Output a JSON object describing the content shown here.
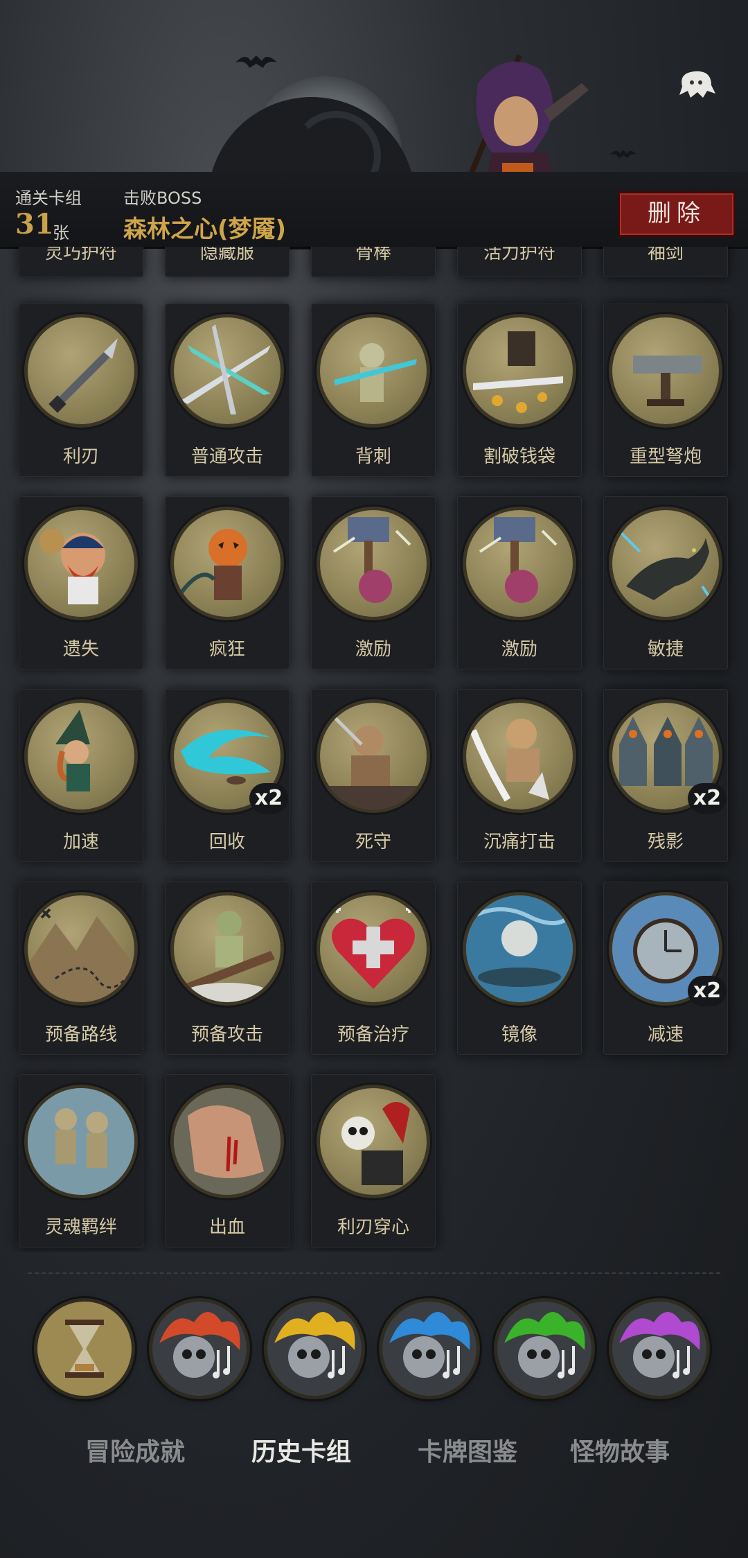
{
  "header": {
    "cleared_label": "通关卡组",
    "cleared_count": "31",
    "cleared_unit": "张",
    "boss_label": "击败BOSS",
    "boss_name": "森林之心(梦魇)",
    "delete_label": "删除"
  },
  "colors": {
    "accent_gold": "#c9a24a",
    "delete_red": "#7a1a18",
    "card_bg": "#1d1f22"
  },
  "top_row_labels": [
    "灵巧护符",
    "隐藏服",
    "骨棒",
    "活力护符",
    "袖剑"
  ],
  "cards": [
    {
      "label": "利刃",
      "icon": "dagger-icon"
    },
    {
      "label": "普通攻击",
      "icon": "slash-icon"
    },
    {
      "label": "背刺",
      "icon": "backstab-icon"
    },
    {
      "label": "割破钱袋",
      "icon": "coin-slash-icon"
    },
    {
      "label": "重型弩炮",
      "icon": "ballista-icon"
    },
    {
      "label": "遗失",
      "icon": "pirate-icon"
    },
    {
      "label": "疯狂",
      "icon": "pumpkin-icon"
    },
    {
      "label": "激励",
      "icon": "hammer-icon"
    },
    {
      "label": "激励",
      "icon": "hammer-icon"
    },
    {
      "label": "敏捷",
      "icon": "panther-icon"
    },
    {
      "label": "加速",
      "icon": "witch-icon"
    },
    {
      "label": "回收",
      "icon": "vortex-icon",
      "count": "x2"
    },
    {
      "label": "死守",
      "icon": "warrior-icon"
    },
    {
      "label": "沉痛打击",
      "icon": "smash-icon"
    },
    {
      "label": "残影",
      "icon": "shadow-icon",
      "count": "x2"
    },
    {
      "label": "预备路线",
      "icon": "map-icon"
    },
    {
      "label": "预备攻击",
      "icon": "puppet-icon"
    },
    {
      "label": "预备治疗",
      "icon": "heart-icon"
    },
    {
      "label": "镜像",
      "icon": "moon-icon"
    },
    {
      "label": "减速",
      "icon": "clock-icon",
      "count": "x2"
    },
    {
      "label": "灵魂羁绊",
      "icon": "souls-icon"
    },
    {
      "label": "出血",
      "icon": "blood-icon"
    },
    {
      "label": "利刃穿心",
      "icon": "skull-icon"
    }
  ],
  "relics": [
    {
      "icon": "hourglass-icon",
      "color": "#9c8a52"
    },
    {
      "icon": "skull-music-icon",
      "color": "#d24a2a"
    },
    {
      "icon": "skull-music-icon",
      "color": "#e0b020"
    },
    {
      "icon": "skull-music-icon",
      "color": "#2f8ad8"
    },
    {
      "icon": "skull-music-icon",
      "color": "#3ab22a"
    },
    {
      "icon": "skull-music-icon",
      "color": "#b04ad0"
    }
  ],
  "tabs": [
    {
      "label": "冒险成就",
      "active": false
    },
    {
      "label": "历史卡组",
      "active": true
    },
    {
      "label": "卡牌图鉴",
      "active": false
    },
    {
      "label": "怪物故事",
      "active": false
    }
  ]
}
